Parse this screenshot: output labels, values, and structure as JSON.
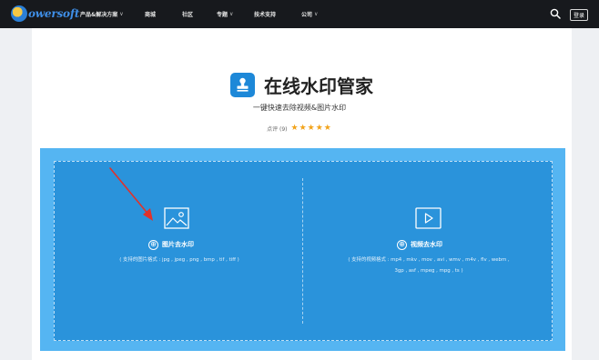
{
  "header": {
    "logo_text": "owersoft",
    "nav": [
      {
        "label": "产品&解决方案",
        "dropdown": true
      },
      {
        "label": "商城",
        "dropdown": false
      },
      {
        "label": "社区",
        "dropdown": false
      },
      {
        "label": "专题",
        "dropdown": true
      },
      {
        "label": "技术支持",
        "dropdown": false
      },
      {
        "label": "公司",
        "dropdown": true
      }
    ],
    "login_label": "登录"
  },
  "app": {
    "title": "在线水印管家",
    "subtitle": "一键快速去除视频&图片水印",
    "rating_label": "点评 (9)",
    "stars": "★★★★★",
    "rating_value": 5
  },
  "image_upload": {
    "label": "图片去水印",
    "plus": "⊕",
    "formats": "( 支持的图片格式 : jpg , jpeg , png , bmp , tif , tiff )"
  },
  "video_upload": {
    "label": "视频去水印",
    "plus": "⊕",
    "formats_line1": "( 支持的视频格式 : mp4 , mkv , mov , avi , wmv , m4v , flv , webm ,",
    "formats_line2": "3gp , asf , mpeg , mpg , ts )"
  },
  "colors": {
    "topbar": "#17191d",
    "panel_outer": "#55b5f2",
    "panel_inner": "#2a93db",
    "brand_blue": "#1d88d8",
    "star": "#f2a31a",
    "arrow": "#e0322b"
  },
  "icons": [
    "logo-icon",
    "search-icon",
    "chevron-down-icon",
    "stamp-icon",
    "image-icon",
    "video-play-icon",
    "plus-circle-icon",
    "red-arrow-annotation"
  ]
}
